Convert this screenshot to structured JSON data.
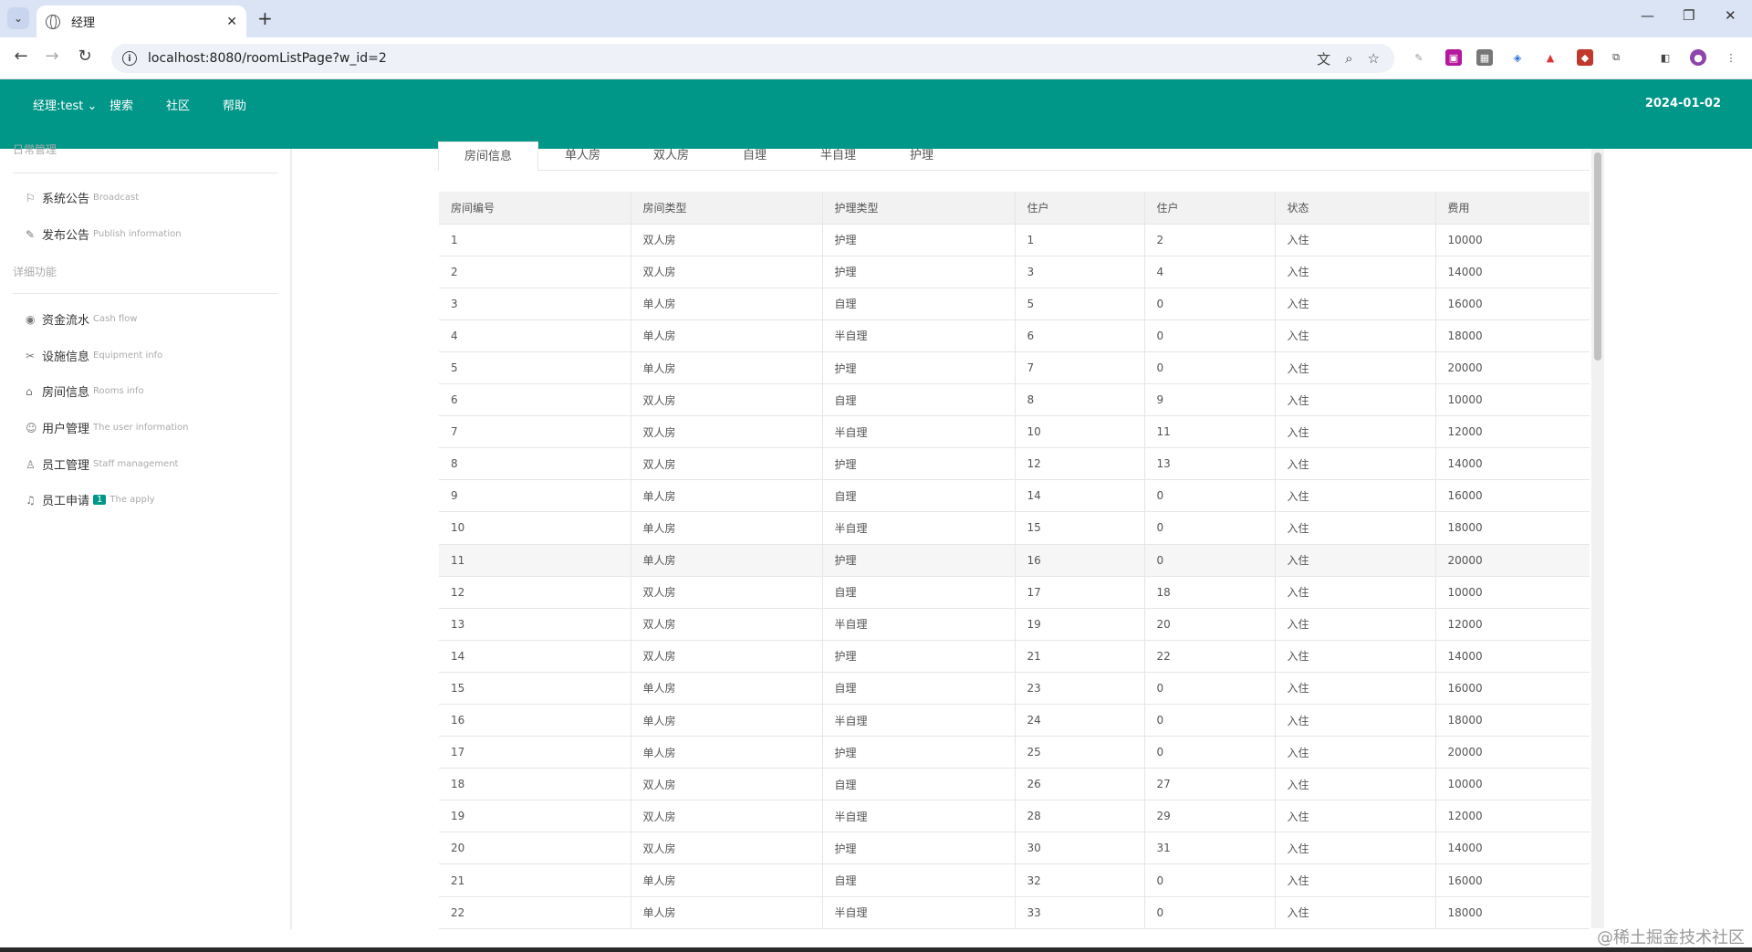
{
  "browser": {
    "tab_title": "经理",
    "url": "localhost:8080/roomListPage?w_id=2"
  },
  "header": {
    "user_menu": "经理:test",
    "nav": [
      "搜索",
      "社区",
      "帮助"
    ],
    "date": "2024-01-02"
  },
  "sidebar": {
    "section_top": "日常管理",
    "items_top": [
      {
        "label": "系统公告",
        "sub": "Broadcast"
      },
      {
        "label": "发布公告",
        "sub": "Publish information"
      }
    ],
    "section_detail": "详细功能",
    "items_detail": [
      {
        "label": "资金流水",
        "sub": "Cash flow"
      },
      {
        "label": "设施信息",
        "sub": "Equipment info"
      },
      {
        "label": "房间信息",
        "sub": "Rooms info"
      },
      {
        "label": "用户管理",
        "sub": "The user information"
      },
      {
        "label": "员工管理",
        "sub": "Staff management"
      },
      {
        "label": "员工申请",
        "badge": "1",
        "sub": "The apply"
      }
    ]
  },
  "content_tabs": [
    "房间信息",
    "单人房",
    "双人房",
    "自理",
    "半自理",
    "护理"
  ],
  "table": {
    "headers": [
      "房间编号",
      "房间类型",
      "护理类型",
      "住户",
      "住户",
      "状态",
      "费用"
    ],
    "rows": [
      [
        "1",
        "双人房",
        "护理",
        "1",
        "2",
        "入住",
        "10000"
      ],
      [
        "2",
        "双人房",
        "护理",
        "3",
        "4",
        "入住",
        "14000"
      ],
      [
        "3",
        "单人房",
        "自理",
        "5",
        "0",
        "入住",
        "16000"
      ],
      [
        "4",
        "单人房",
        "半自理",
        "6",
        "0",
        "入住",
        "18000"
      ],
      [
        "5",
        "单人房",
        "护理",
        "7",
        "0",
        "入住",
        "20000"
      ],
      [
        "6",
        "双人房",
        "自理",
        "8",
        "9",
        "入住",
        "10000"
      ],
      [
        "7",
        "双人房",
        "半自理",
        "10",
        "11",
        "入住",
        "12000"
      ],
      [
        "8",
        "双人房",
        "护理",
        "12",
        "13",
        "入住",
        "14000"
      ],
      [
        "9",
        "单人房",
        "自理",
        "14",
        "0",
        "入住",
        "16000"
      ],
      [
        "10",
        "单人房",
        "半自理",
        "15",
        "0",
        "入住",
        "18000"
      ],
      [
        "11",
        "单人房",
        "护理",
        "16",
        "0",
        "入住",
        "20000"
      ],
      [
        "12",
        "双人房",
        "自理",
        "17",
        "18",
        "入住",
        "10000"
      ],
      [
        "13",
        "双人房",
        "半自理",
        "19",
        "20",
        "入住",
        "12000"
      ],
      [
        "14",
        "双人房",
        "护理",
        "21",
        "22",
        "入住",
        "14000"
      ],
      [
        "15",
        "单人房",
        "自理",
        "23",
        "0",
        "入住",
        "16000"
      ],
      [
        "16",
        "单人房",
        "半自理",
        "24",
        "0",
        "入住",
        "18000"
      ],
      [
        "17",
        "单人房",
        "护理",
        "25",
        "0",
        "入住",
        "20000"
      ],
      [
        "18",
        "双人房",
        "自理",
        "26",
        "27",
        "入住",
        "10000"
      ],
      [
        "19",
        "双人房",
        "半自理",
        "28",
        "29",
        "入住",
        "12000"
      ],
      [
        "20",
        "双人房",
        "护理",
        "30",
        "31",
        "入住",
        "14000"
      ],
      [
        "21",
        "单人房",
        "自理",
        "32",
        "0",
        "入住",
        "16000"
      ],
      [
        "22",
        "单人房",
        "半自理",
        "33",
        "0",
        "入住",
        "18000"
      ]
    ]
  },
  "watermark": "@稀土掘金技术社区",
  "colors": {
    "header_bg": "#009688",
    "tabbar_bg": "#dbe4f5",
    "badge_bg": "#009688"
  }
}
